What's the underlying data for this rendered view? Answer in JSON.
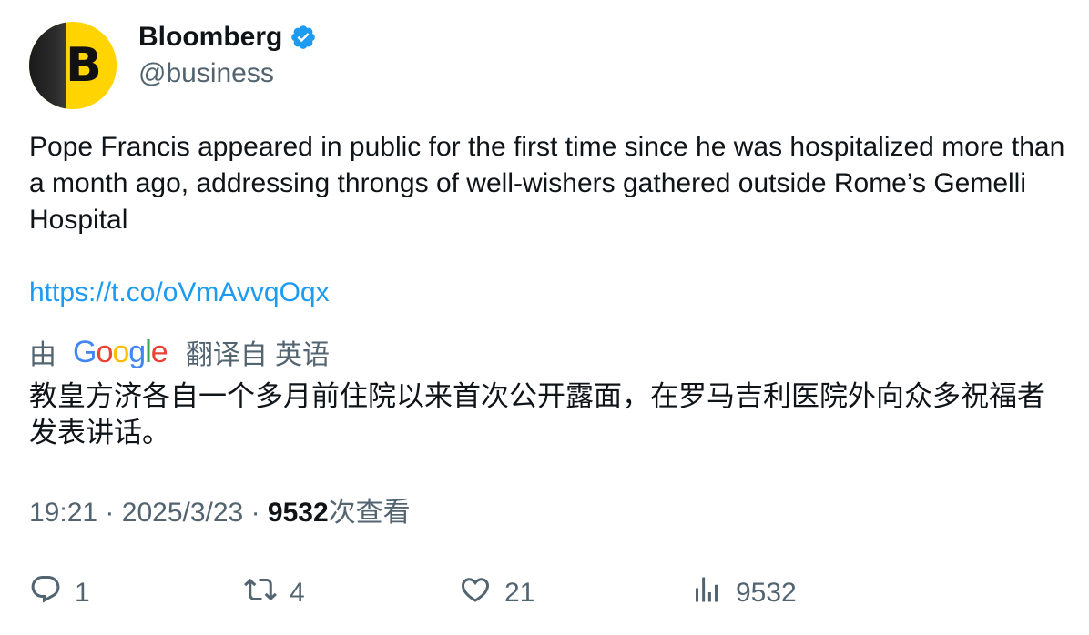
{
  "account": {
    "name": "Bloomberg",
    "handle": "@business",
    "avatar_letter": "B"
  },
  "tweet": {
    "text": "Pope Francis appeared in public for the first time since he was hospitalized more than a month ago, addressing throngs of well-wishers gathered outside Rome’s Gemelli Hospital",
    "link": "https://t.co/oVmAvvqOqx"
  },
  "translation": {
    "prefix": "由",
    "provider": "Google",
    "suffix": "翻译自 英语",
    "text": "教皇方济各自一个多月前住院以来首次公开露面，在罗马吉利医院外向众多祝福者发表讲话。"
  },
  "meta": {
    "time": "19:21",
    "separator": "·",
    "date": "2025/3/23",
    "views": "9532",
    "views_label": "次查看"
  },
  "actions": {
    "reply": {
      "icon": "reply-icon",
      "count": "1"
    },
    "retweet": {
      "icon": "retweet-icon",
      "count": "4"
    },
    "like": {
      "icon": "heart-icon",
      "count": "21"
    },
    "views": {
      "icon": "analytics-icon",
      "count": "9532"
    }
  },
  "colors": {
    "link": "#1d9bf0",
    "secondary_text": "#536471",
    "primary_text": "#0f1419",
    "verified": "#1d9bf0",
    "avatar_yellow": "#ffd400"
  }
}
